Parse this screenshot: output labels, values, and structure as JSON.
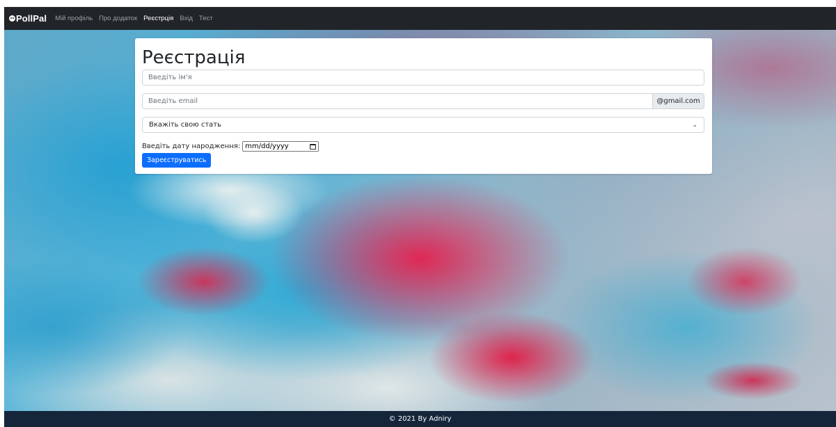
{
  "navbar": {
    "brand": "PollPal",
    "brand_icon": "smiley-icon",
    "links": [
      {
        "label": "Мій профіль",
        "active": false
      },
      {
        "label": "Про додаток",
        "active": false
      },
      {
        "label": "Реєстрція",
        "active": true
      },
      {
        "label": "Вхід",
        "active": false
      },
      {
        "label": "Тест",
        "active": false
      }
    ]
  },
  "form": {
    "title": "Реєстрація",
    "name_placeholder": "Введіть ім'я",
    "email_placeholder": "Введіть email",
    "email_suffix": "@gmail.com",
    "gender_select": "Вкажіть свою стать",
    "dob_label": "Введіть дату народження:",
    "dob_value": "mm/dd/yyyy",
    "submit_label": "Зареєструватись"
  },
  "footer": {
    "text": "© 2021 By Adniry"
  },
  "colors": {
    "navbar_bg": "#212529",
    "primary_button": "#0d6efd",
    "footer_bg": "#15263b"
  }
}
